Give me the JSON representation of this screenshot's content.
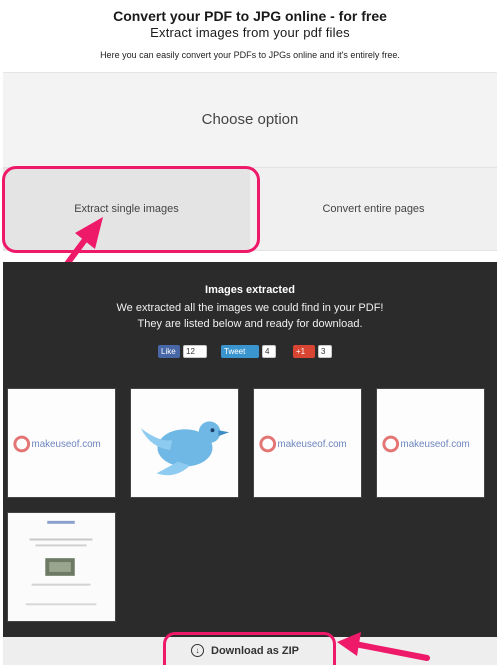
{
  "header": {
    "title": "Convert your PDF to JPG online - for free",
    "subtitle": "Extract images from your pdf files",
    "description": "Here you can easily convert your PDFs to JPGs online and it's entirely free."
  },
  "choose": {
    "label": "Choose option"
  },
  "options": [
    {
      "label": "Extract single images",
      "selected": true
    },
    {
      "label": "Convert entire pages",
      "selected": false
    }
  ],
  "results": {
    "title": "Images extracted",
    "line1": "We extracted all the images we could find in your PDF!",
    "line2": "They are listed below and ready for download."
  },
  "social": {
    "facebook": {
      "label": "Like",
      "count": "12"
    },
    "twitter": {
      "label": "Tweet",
      "count": "4"
    },
    "google": {
      "label": "+1",
      "count": "3"
    }
  },
  "thumbnails": [
    {
      "type": "logo",
      "logo_text": "makeuseof.com"
    },
    {
      "type": "bird"
    },
    {
      "type": "logo",
      "logo_text": "makeuseof.com"
    },
    {
      "type": "logo",
      "logo_text": "makeuseof.com"
    },
    {
      "type": "page"
    }
  ],
  "download": {
    "label": "Download as ZIP"
  },
  "colors": {
    "highlight": "#ee1a69",
    "dark_panel": "#2b2b2b",
    "facebook": "#4767a7",
    "twitter": "#3a95cf",
    "google": "#d84532"
  }
}
